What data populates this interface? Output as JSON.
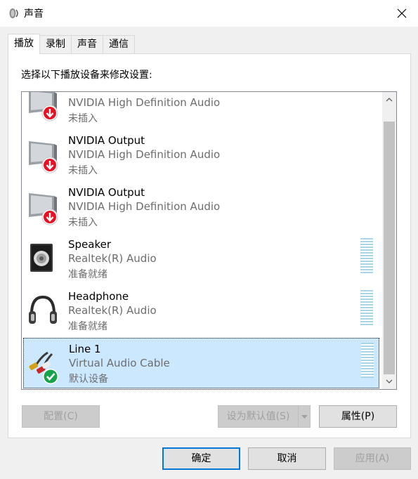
{
  "window": {
    "title": "声音",
    "title_icon": "speaker-icon",
    "close_icon": "close-icon"
  },
  "tabs": [
    {
      "label": "播放",
      "active": true
    },
    {
      "label": "录制",
      "active": false
    },
    {
      "label": "声音",
      "active": false
    },
    {
      "label": "通信",
      "active": false
    }
  ],
  "instruction": "选择以下播放设备来修改设置:",
  "devices": [
    {
      "name": "",
      "driver": "NVIDIA High Definition Audio",
      "status": "未插入",
      "icon": "monitor-unplugged-icon",
      "selected": false
    },
    {
      "name": "NVIDIA Output",
      "driver": "NVIDIA High Definition Audio",
      "status": "未插入",
      "icon": "monitor-unplugged-icon",
      "selected": false
    },
    {
      "name": "NVIDIA Output",
      "driver": "NVIDIA High Definition Audio",
      "status": "未插入",
      "icon": "monitor-unplugged-icon",
      "selected": false
    },
    {
      "name": "Speaker",
      "driver": "Realtek(R) Audio",
      "status": "准备就绪",
      "icon": "speaker-box-icon",
      "selected": false
    },
    {
      "name": "Headphone",
      "driver": "Realtek(R) Audio",
      "status": "准备就绪",
      "icon": "headphone-icon",
      "selected": false
    },
    {
      "name": "Line 1",
      "driver": "Virtual Audio Cable",
      "status": "默认设备",
      "icon": "audio-cable-default-icon",
      "selected": true
    }
  ],
  "buttons": {
    "configure": "配置(C)",
    "set_default": "设为默认值(S)",
    "properties": "属性(P)",
    "ok": "确定",
    "cancel": "取消",
    "apply": "应用(A)"
  },
  "colors": {
    "selection": "#cce8ff",
    "level_meter": "#a9d5e9",
    "unplugged_badge": "#e81123",
    "default_badge": "#16a34a"
  }
}
